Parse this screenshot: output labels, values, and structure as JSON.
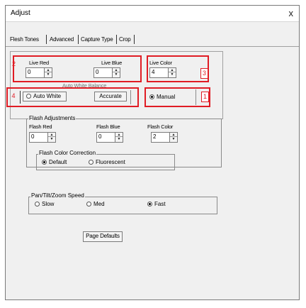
{
  "window": {
    "title": "Adjust",
    "close_glyph": "x"
  },
  "tabs": [
    "Flesh Tones",
    "Advanced",
    "Capture Type",
    "Crop"
  ],
  "top_panel": {
    "live_red": {
      "label": "Live Red",
      "value": "0"
    },
    "live_blue": {
      "label": "Live Blue",
      "value": "0"
    },
    "live_color": {
      "label": "Live Color",
      "value": "4"
    },
    "mode_buttons": [
      "Auto White",
      "Accurate"
    ],
    "manual_label": "Manual",
    "clipped_label": "Auto White Balance"
  },
  "callouts": [
    "1",
    "2",
    "3",
    "4"
  ],
  "flash": {
    "group_label": "Flash Adjustments",
    "red": {
      "label": "Flash Red",
      "value": "0"
    },
    "blue": {
      "label": "Flash Blue",
      "value": "0"
    },
    "color": {
      "label": "Flash Color",
      "value": "2"
    },
    "correction": {
      "label": "Flash Color Correction",
      "options": [
        "Default",
        "Fluorescent"
      ],
      "selected": "Default"
    }
  },
  "ptz": {
    "label": "Pan/Tilt/Zoom Speed",
    "options": [
      "Slow",
      "Med",
      "Fast"
    ],
    "selected": "Fast"
  },
  "page_defaults_label": "Page Defaults",
  "colors": {
    "callout_red": "#e01c24",
    "window_bg": "#f0f0f0"
  }
}
